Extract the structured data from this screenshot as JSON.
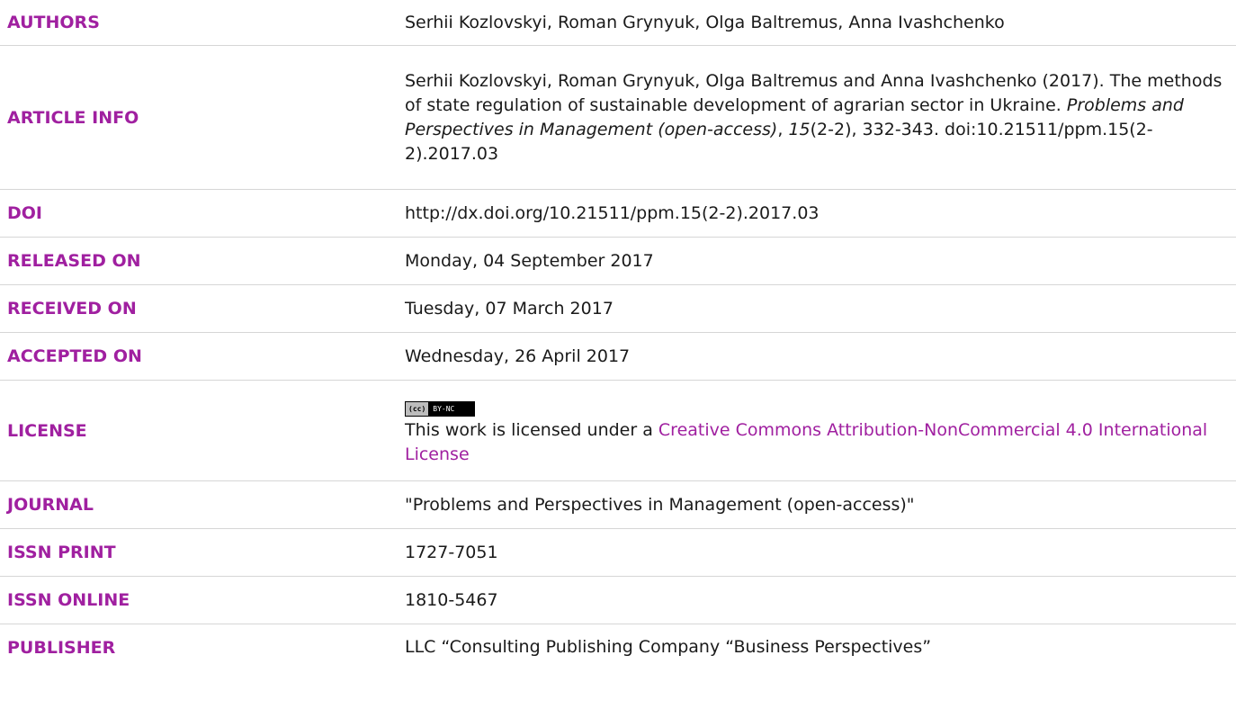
{
  "rows": {
    "authors": {
      "label": "AUTHORS",
      "value": "Serhii Kozlovskyi, Roman Grynyuk, Olga Baltremus, Anna Ivashchenko"
    },
    "article_info": {
      "label": "ARTICLE INFO",
      "cite_part1": "Serhii Kozlovskyi, Roman Grynyuk, Olga Baltremus and Anna Ivashchenko (2017). The methods of state regulation of sustainable development of agrarian sector in Ukraine. ",
      "cite_journal": "Problems and Perspectives in Management (open-access)",
      "cite_sep": ", ",
      "cite_volume": "15",
      "cite_part2": "(2-2), 332-343. doi:10.21511/ppm.15(2-2).2017.03"
    },
    "doi": {
      "label": "DOI",
      "value": "http://dx.doi.org/10.21511/ppm.15(2-2).2017.03"
    },
    "released": {
      "label": "RELEASED ON",
      "value": "Monday, 04 September 2017"
    },
    "received": {
      "label": "RECEIVED ON",
      "value": "Tuesday, 07 March 2017"
    },
    "accepted": {
      "label": "ACCEPTED ON",
      "value": "Wednesday, 26 April 2017"
    },
    "license": {
      "label": "LICENSE",
      "badge_left": "(cc)",
      "badge_right": "BY-NC",
      "text": "This work is licensed under a ",
      "link": "Creative Commons Attribution-NonCommercial 4.0 International License"
    },
    "journal": {
      "label": "JOURNAL",
      "value": "\"Problems and Perspectives in Management (open-access)\""
    },
    "issn_print": {
      "label": "ISSN PRINT",
      "value": "1727-7051"
    },
    "issn_online": {
      "label": "ISSN ONLINE",
      "value": "1810-5467"
    },
    "publisher": {
      "label": "PUBLISHER",
      "value": "LLC “Consulting Publishing Company “Business Perspectives”"
    }
  },
  "colors": {
    "label": "#a020a0",
    "divider": "#d6d6d6",
    "text": "#1a1a1a"
  }
}
